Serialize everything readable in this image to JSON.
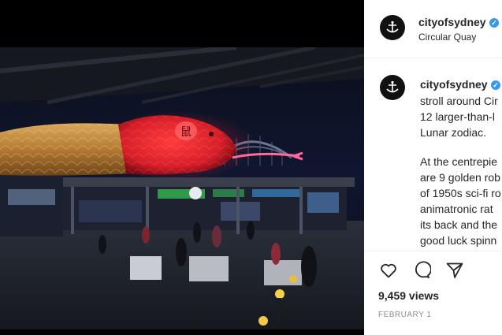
{
  "header": {
    "username": "cityofsydney",
    "location": "Circular Quay"
  },
  "caption": {
    "username": "cityofsydney",
    "lines": [
      "stroll around Cir",
      "12 larger-than-l",
      "Lunar zodiac.",
      "",
      "At the centrepie",
      "are 9 golden rob",
      "of 1950s sci-fi ro",
      "animatronic rat",
      "its back and the",
      "good luck spinn"
    ]
  },
  "post": {
    "views": "9,459 views",
    "date": "FEBRUARY 1"
  },
  "media": {
    "neon_sign": "鼠"
  },
  "icons": {
    "avatar": "harbour-logo-icon",
    "verified": "verified-badge-icon",
    "like": "heart-icon",
    "comment": "comment-icon",
    "share": "share-icon"
  },
  "colors": {
    "verified": "#3897f0",
    "text": "#262626",
    "muted": "#8e8e8e"
  }
}
